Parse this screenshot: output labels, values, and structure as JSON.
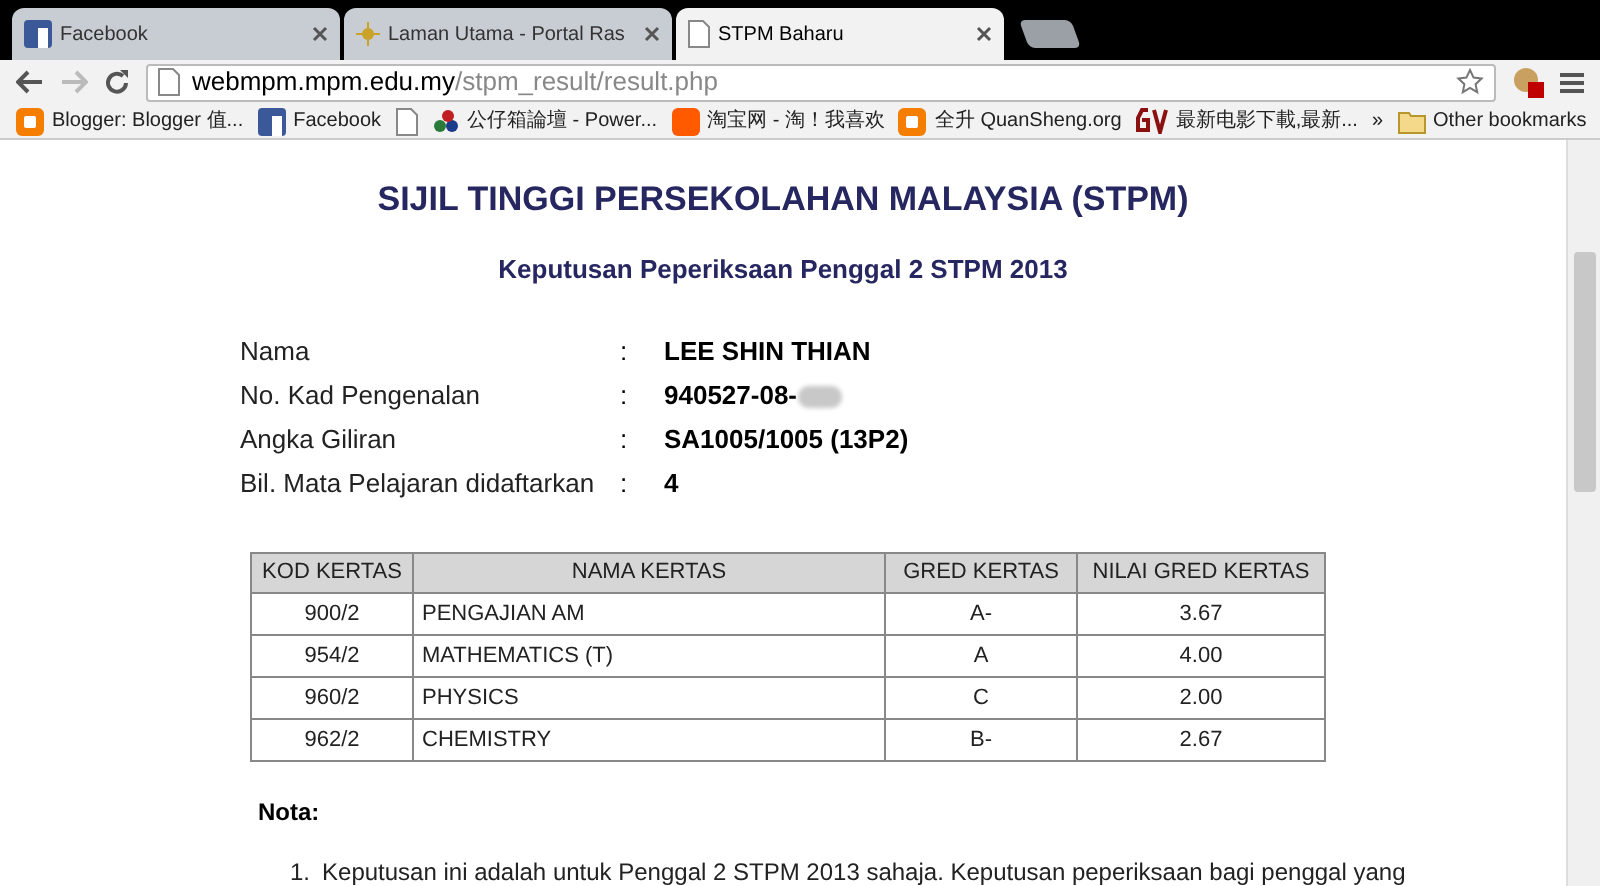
{
  "tabs": [
    {
      "label": "Facebook",
      "kind": "facebook",
      "selected": false
    },
    {
      "label": "Laman Utama - Portal Ras",
      "kind": "star",
      "selected": false
    },
    {
      "label": "STPM Baharu",
      "kind": "page",
      "selected": true
    }
  ],
  "address": {
    "host": "webmpm.mpm.edu.my",
    "path": "/stpm_result/result.php"
  },
  "bookmarks": [
    {
      "label": "Blogger: Blogger 值...",
      "kind": "blogger"
    },
    {
      "label": "Facebook",
      "kind": "facebook"
    },
    {
      "kind": "page"
    },
    {
      "label": "公仔箱論壇 - Power...",
      "kind": "dots"
    },
    {
      "label": "淘宝网 - 淘！我喜欢",
      "kind": "taobao"
    },
    {
      "label": "全升 QuanSheng.org",
      "kind": "blogger"
    },
    {
      "label": "最新电影下載,最新...",
      "kind": "movie"
    }
  ],
  "bookmarks_overflow": "»",
  "other_bookmarks": "Other bookmarks",
  "page": {
    "title": "SIJIL TINGGI PERSEKOLAHAN MALAYSIA (STPM)",
    "subtitle": "Keputusan Peperiksaan Penggal 2 STPM 2013",
    "fields": [
      {
        "label": "Nama",
        "separator": ":",
        "value": "LEE SHIN THIAN",
        "redacted": false
      },
      {
        "label": "No. Kad Pengenalan",
        "separator": ":",
        "value": "940527-08-",
        "redacted": true
      },
      {
        "label": "Angka Giliran",
        "separator": ":",
        "value": "SA1005/1005 (13P2)",
        "redacted": false
      },
      {
        "label": "Bil. Mata Pelajaran didaftarkan",
        "separator": ":",
        "value": "4",
        "redacted": false
      }
    ],
    "table": {
      "columns": [
        "KOD KERTAS",
        "NAMA KERTAS",
        "GRED KERTAS",
        "NILAI GRED KERTAS"
      ],
      "rows": [
        [
          "900/2",
          "PENGAJIAN AM",
          "A-",
          "3.67"
        ],
        [
          "954/2",
          "MATHEMATICS (T)",
          "A",
          "4.00"
        ],
        [
          "960/2",
          "PHYSICS",
          "C",
          "2.00"
        ],
        [
          "962/2",
          "CHEMISTRY",
          "B-",
          "2.67"
        ]
      ]
    },
    "note_heading": "Nota:",
    "notes": [
      {
        "number": "1.",
        "text": "Keputusan ini adalah untuk Penggal 2 STPM 2013 sahaja. Keputusan peperiksaan bagi penggal yang"
      }
    ]
  }
}
